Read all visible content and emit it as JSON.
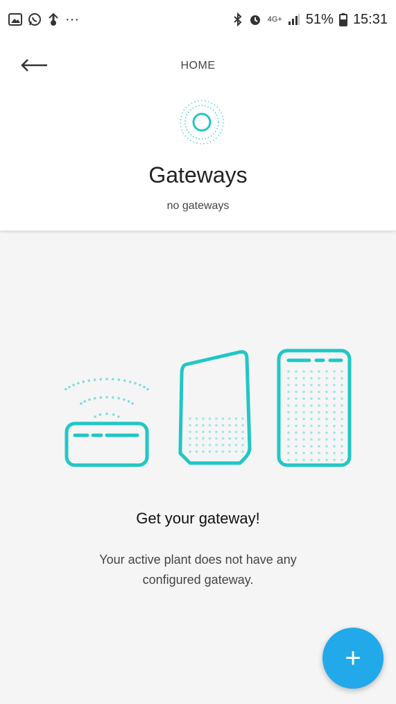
{
  "status_bar": {
    "left_icons": [
      "gallery-icon",
      "whatsapp-icon",
      "app-notification-icon",
      "more-notifications-icon"
    ],
    "overflow_text": "···",
    "right_icons": [
      "bluetooth-icon",
      "alarm-icon",
      "network-4g-icon",
      "signal-icon",
      "battery-icon"
    ],
    "network_label": "4G+",
    "battery_percent": "51%",
    "time": "15:31"
  },
  "header": {
    "back_icon": "arrow-left-icon",
    "nav_title": "HOME",
    "section_icon": "gateway-radar-icon",
    "title": "Gateways",
    "subtitle": "no gateways"
  },
  "empty_state": {
    "illustration": "gateway-devices-illustration",
    "title": "Get your gateway!",
    "description": "Your active plant does not have any configured gateway."
  },
  "fab": {
    "icon": "plus-icon",
    "label": "+"
  },
  "colors": {
    "accent": "#22c6c6",
    "fab": "#22a9ea",
    "background": "#f5f5f5"
  }
}
